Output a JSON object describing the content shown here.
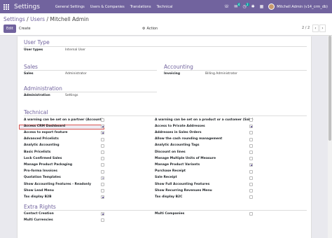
{
  "navbar": {
    "brand": "Settings",
    "menus": [
      "General Settings",
      "Users & Companies",
      "Translations",
      "Technical"
    ],
    "chat_badge": "4",
    "activity_badge": "2",
    "user": "Mitchell Admin (v14_crm_db)"
  },
  "breadcrumb": [
    "Settings",
    "Users",
    "Mitchell Admin"
  ],
  "breadcrumb_sep": "/",
  "buttons": {
    "edit": "Edit",
    "create": "Create",
    "action": "Action"
  },
  "pager": {
    "value": "2 / 2",
    "prev": "‹",
    "next": "›"
  },
  "user_type": {
    "title": "User Type",
    "label": "User types",
    "value": "Internal User"
  },
  "sales": {
    "title": "Sales",
    "label": "Sales",
    "value": "Administrator"
  },
  "accounting": {
    "title": "Accounting",
    "label": "Invoicing",
    "value": "Billing Administrator"
  },
  "administration": {
    "title": "Administration",
    "label": "Administration",
    "value": "Settings"
  },
  "technical": {
    "title": "Technical",
    "left": [
      {
        "label": "A warning can be set on a partner (Account)",
        "checked": false
      },
      {
        "label": "Access CRM Dashboard",
        "checked": true
      },
      {
        "label": "Access to export feature",
        "checked": true
      },
      {
        "label": "Advanced Pricelists",
        "checked": false
      },
      {
        "label": "Analytic Accounting",
        "checked": false
      },
      {
        "label": "Basic Pricelists",
        "checked": false
      },
      {
        "label": "Lock Confirmed Sales",
        "checked": false
      },
      {
        "label": "Manage Product Packaging",
        "checked": false
      },
      {
        "label": "Pro-forma Invoices",
        "checked": false
      },
      {
        "label": "Quotation Templates",
        "checked": true
      },
      {
        "label": "Show Accounting Features - Readonly",
        "checked": false
      },
      {
        "label": "Show Lead Menu",
        "checked": false
      },
      {
        "label": "Tax display B2B",
        "checked": true
      }
    ],
    "right": [
      {
        "label": "A warning can be set on a product or a customer (Sale)",
        "checked": false
      },
      {
        "label": "Access to Private Addresses",
        "checked": true
      },
      {
        "label": "Addresses in Sales Orders",
        "checked": false
      },
      {
        "label": "Allow the cash rounding management",
        "checked": false
      },
      {
        "label": "Analytic Accounting Tags",
        "checked": false
      },
      {
        "label": "Discount on lines",
        "checked": false
      },
      {
        "label": "Manage Multiple Units of Measure",
        "checked": false
      },
      {
        "label": "Manage Product Variants",
        "checked": true
      },
      {
        "label": "Purchase Receipt",
        "checked": false
      },
      {
        "label": "Sale Receipt",
        "checked": false
      },
      {
        "label": "Show Full Accounting Features",
        "checked": false
      },
      {
        "label": "Show Recurring Revenues Menu",
        "checked": false
      },
      {
        "label": "Tax display B2C",
        "checked": false
      }
    ]
  },
  "extra_rights": {
    "title": "Extra Rights",
    "left": [
      {
        "label": "Contact Creation",
        "checked": true
      },
      {
        "label": "Multi Currencies",
        "checked": false
      }
    ],
    "right": [
      {
        "label": "Multi Companies",
        "checked": false
      }
    ]
  },
  "colors": {
    "brand": "#71639e",
    "highlight_border": "#d9534f"
  }
}
